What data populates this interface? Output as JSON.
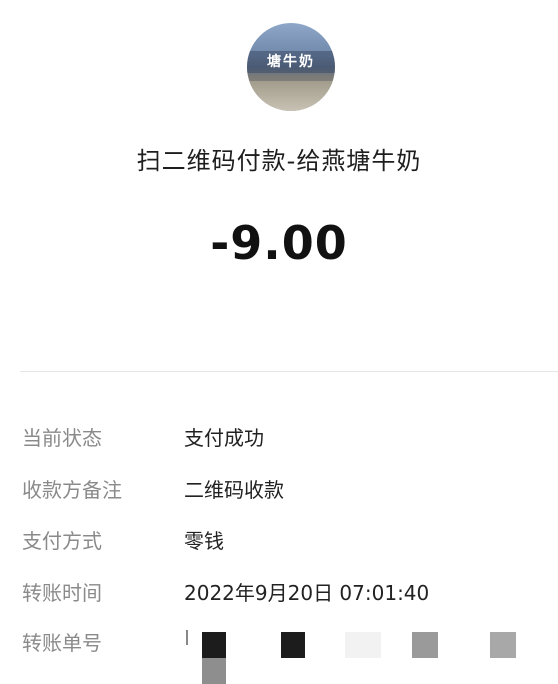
{
  "merchant": {
    "avatar_text": "塘牛奶",
    "title": "扫二维码付款-给燕塘牛奶"
  },
  "amount": "-9.00",
  "details": {
    "status": {
      "label": "当前状态",
      "value": "支付成功"
    },
    "payee_note": {
      "label": "收款方备注",
      "value": "二维码收款"
    },
    "payment_method": {
      "label": "支付方式",
      "value": "零钱"
    },
    "transfer_time": {
      "label": "转账时间",
      "value": "2022年9月20日 07:01:40"
    },
    "transfer_number": {
      "label": "转账单号"
    }
  },
  "colors": {
    "label": "#8a8a8a",
    "value": "#222222",
    "divider": "#e6e6e6"
  }
}
